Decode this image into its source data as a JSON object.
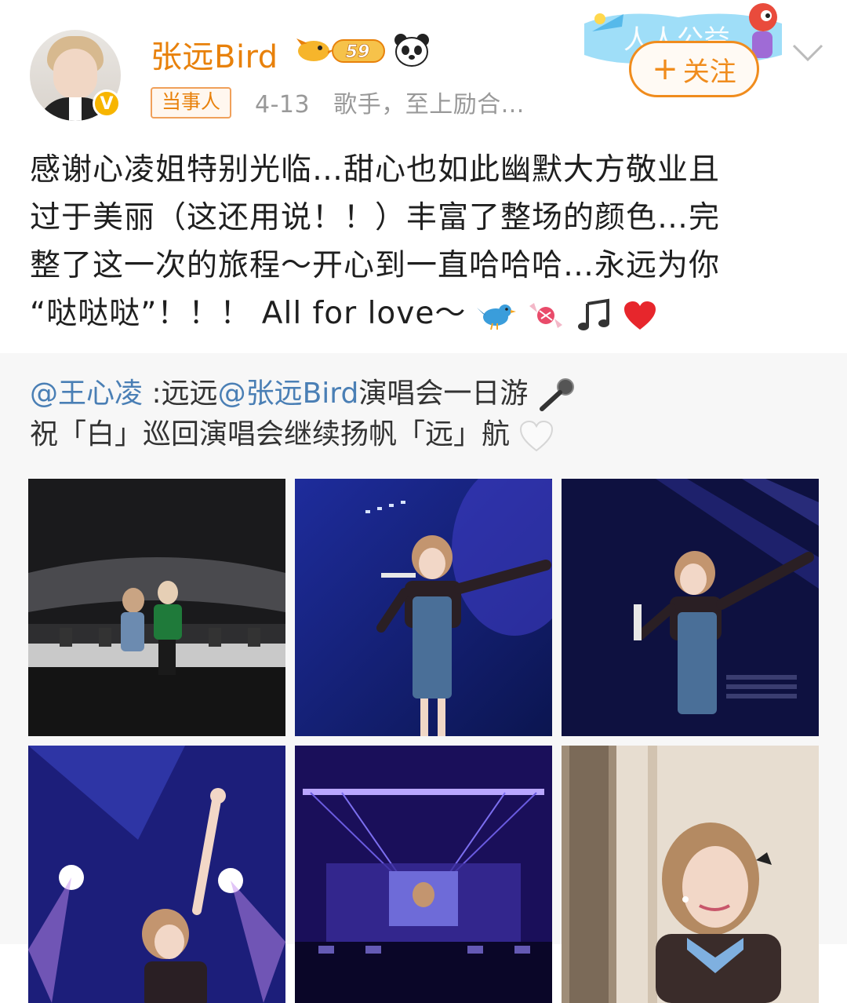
{
  "post": {
    "username": "张远Bird",
    "level_badge": "59",
    "tag": "当事人",
    "date": "4-13",
    "bio": "歌手，至上励合...",
    "follow_label": "关注",
    "follow_plus": "+",
    "text_line1": "感谢心凌姐特别光临…甜心也如此幽默大方敬业且",
    "text_line2": "过于美丽（这还用说！！）丰富了整场的颜色…完",
    "text_line3": "整了这一次的旅程～开心到一直哈哈哈…永远为你",
    "text_line4": "“哒哒哒”！！！ All for love～"
  },
  "repost": {
    "mention_author": "@王心凌",
    "text_part1": " :远远",
    "mention_bird": "@张远Bird",
    "text_part2": "演唱会一日游",
    "line2": "祝「白」巡回演唱会继续扬帆「远」航"
  },
  "icons": {
    "avatar": "avatar",
    "verified": "verified-badge-icon",
    "panda": "panda-icon",
    "chevron": "chevron-down-icon",
    "bird": "bird-emoji-icon",
    "candy": "candy-emoji-icon",
    "music": "music-note-emoji-icon",
    "heart": "red-heart-emoji-icon",
    "mic": "microphone-emoji-icon",
    "white_heart": "white-heart-emoji-icon"
  },
  "colors": {
    "username": "#e8810b",
    "follow": "#f08c1d",
    "mention": "#4a7fb5",
    "meta": "#999999",
    "repost_bg": "#f7f7f7"
  }
}
